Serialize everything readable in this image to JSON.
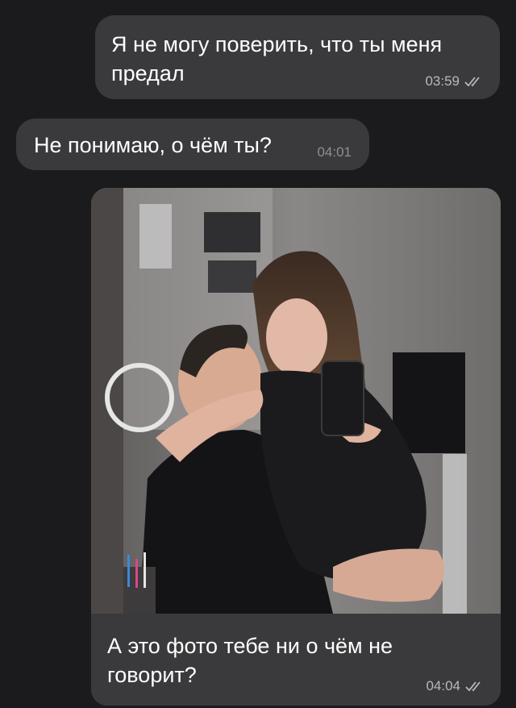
{
  "messages": [
    {
      "direction": "outgoing",
      "text": "Я не могу поверить, что ты меня предал",
      "time": "03:59",
      "status_icon": "double-check-icon"
    },
    {
      "direction": "incoming",
      "text": "Не понимаю, о чём ты?",
      "time": "04:01"
    },
    {
      "direction": "outgoing",
      "type": "photo",
      "caption": "А это фото тебе ни о чём не говорит?",
      "time": "04:04",
      "status_icon": "double-check-icon"
    }
  ],
  "colors": {
    "background": "#1b1b1d",
    "bubble": "#3a3a3c",
    "text": "#ffffff",
    "meta": "#b9b9bd"
  }
}
